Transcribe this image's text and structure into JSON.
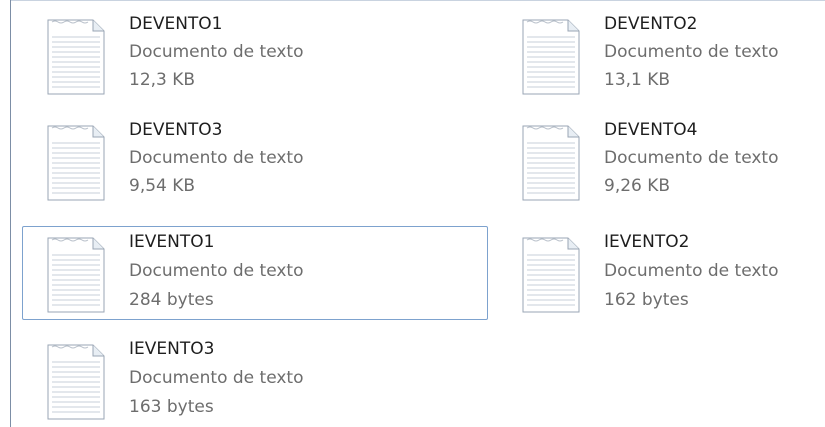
{
  "files": [
    {
      "name": "DEVENTO1",
      "type": "Documento de texto",
      "size": "12,3 KB",
      "icon": "text-file-icon"
    },
    {
      "name": "DEVENTO2",
      "type": "Documento de texto",
      "size": "13,1 KB",
      "icon": "text-file-icon"
    },
    {
      "name": "DEVENTO3",
      "type": "Documento de texto",
      "size": "9,54 KB",
      "icon": "text-file-icon"
    },
    {
      "name": "DEVENTO4",
      "type": "Documento de texto",
      "size": "9,26 KB",
      "icon": "text-file-icon"
    },
    {
      "name": "IEVENTO1",
      "type": "Documento de texto",
      "size": "284 bytes",
      "icon": "text-file-icon",
      "focused": true
    },
    {
      "name": "IEVENTO2",
      "type": "Documento de texto",
      "size": "162 bytes",
      "icon": "text-file-icon"
    },
    {
      "name": "IEVENTO3",
      "type": "Documento de texto",
      "size": "163 bytes",
      "icon": "text-file-icon"
    }
  ],
  "colors": {
    "focus_border": "#7da2ce",
    "name_text": "#1e1e1e",
    "detail_text": "#6d6d6d"
  }
}
